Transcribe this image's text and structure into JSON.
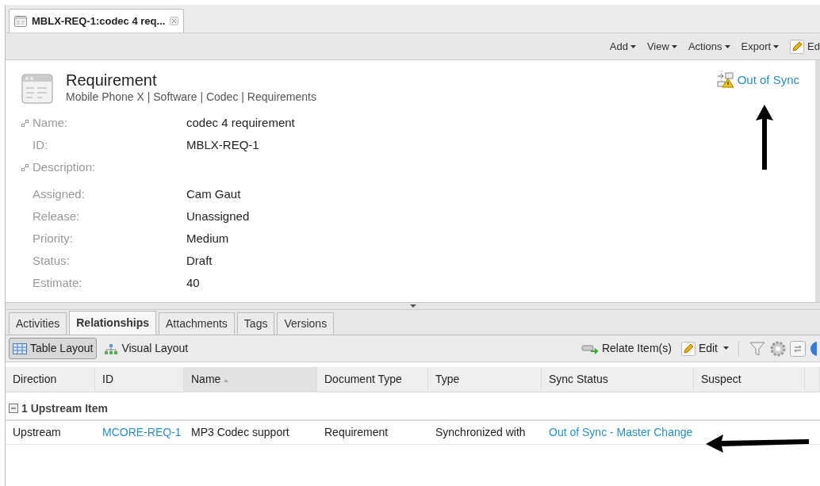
{
  "document_tab": {
    "title": "MBLX-REQ-1:codec 4 req...",
    "selected": true
  },
  "toolbar": {
    "menus": [
      "Add",
      "View",
      "Actions",
      "Export"
    ],
    "edit_button": "Ed"
  },
  "header": {
    "title": "Requirement",
    "breadcrumb": "Mobile Phone X | Software | Codec | Requirements",
    "sync_status": "Out of Sync"
  },
  "fields": [
    {
      "label": "Name:",
      "value": "codec 4 requirement",
      "linked": true
    },
    {
      "label": "ID:",
      "value": "MBLX-REQ-1",
      "linked": false
    },
    {
      "label": "Description:",
      "linked": true
    }
  ],
  "attributes": [
    {
      "label": "Assigned:",
      "value": "Cam Gaut"
    },
    {
      "label": "Release:",
      "value": "Unassigned"
    },
    {
      "label": "Priority:",
      "value": "Medium"
    },
    {
      "label": "Status:",
      "value": "Draft"
    },
    {
      "label": "Estimate:",
      "value": "40"
    }
  ],
  "detail_tabs": [
    {
      "label": "Activities",
      "selected": false
    },
    {
      "label": "Relationships",
      "selected": true
    },
    {
      "label": "Attachments",
      "selected": false
    },
    {
      "label": "Tags",
      "selected": false
    },
    {
      "label": "Versions",
      "selected": false
    }
  ],
  "layouts": [
    {
      "label": "Table Layout",
      "kind": "table",
      "selected": true
    },
    {
      "label": "Visual Layout",
      "kind": "visual",
      "selected": false
    }
  ],
  "table_toolbar": {
    "relate": "Relate Item(s)",
    "edit": "Edit"
  },
  "table": {
    "columns": [
      {
        "label": "Direction"
      },
      {
        "label": "ID"
      },
      {
        "label": "Name",
        "sorted": true
      },
      {
        "label": "Document Type"
      },
      {
        "label": "Type"
      },
      {
        "label": "Sync Status"
      },
      {
        "label": "Suspect"
      }
    ],
    "groups": [
      {
        "label": "1 Upstream Item",
        "expanded": true,
        "rows": [
          {
            "cells": [
              {
                "text": "Upstream",
                "link": false
              },
              {
                "text": "MCORE-REQ-1",
                "link": true
              },
              {
                "text": "MP3 Codec support",
                "link": false
              },
              {
                "text": "Requirement",
                "link": false
              },
              {
                "text": "Synchronized with",
                "link": false
              },
              {
                "text": "Out of Sync - Master Change",
                "link": true
              },
              {
                "text": "",
                "link": false
              }
            ]
          }
        ]
      }
    ]
  }
}
